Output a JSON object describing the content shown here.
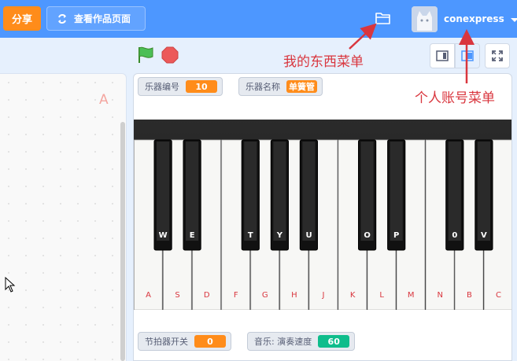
{
  "menubar": {
    "share_label": "分享",
    "project_page_label": "查看作品页面",
    "username": "conexpress",
    "icons": {
      "folder": "folder-icon",
      "caret": "chevron-down-icon",
      "swap": "refresh-icon"
    }
  },
  "code_area": {
    "letter": "A"
  },
  "annotations": {
    "my_stuff": "我的东西菜单",
    "account": "个人账号菜单",
    "color": "#d9363e"
  },
  "monitors": {
    "instrument_id": {
      "label": "乐器编号",
      "value": "10"
    },
    "instrument_name": {
      "label": "乐器名称",
      "value": "单簧管"
    },
    "metronome": {
      "label": "节拍器开关",
      "value": "0"
    },
    "tempo": {
      "label": "音乐: 演奏速度",
      "value": "60"
    }
  },
  "piano": {
    "white_keys": [
      "A",
      "S",
      "D",
      "F",
      "G",
      "H",
      "J",
      "K",
      "L",
      "M",
      "N",
      "B",
      "C"
    ],
    "black_keys": [
      "W",
      "E",
      "T",
      "Y",
      "U",
      "O",
      "P",
      "0",
      "V"
    ]
  },
  "colors": {
    "menubar": "#4d97ff",
    "share": "#ff8c1a",
    "accent_orange": "#ff8c1a",
    "accent_teal": "#0fbd8c",
    "key_label": "#d9363e"
  }
}
